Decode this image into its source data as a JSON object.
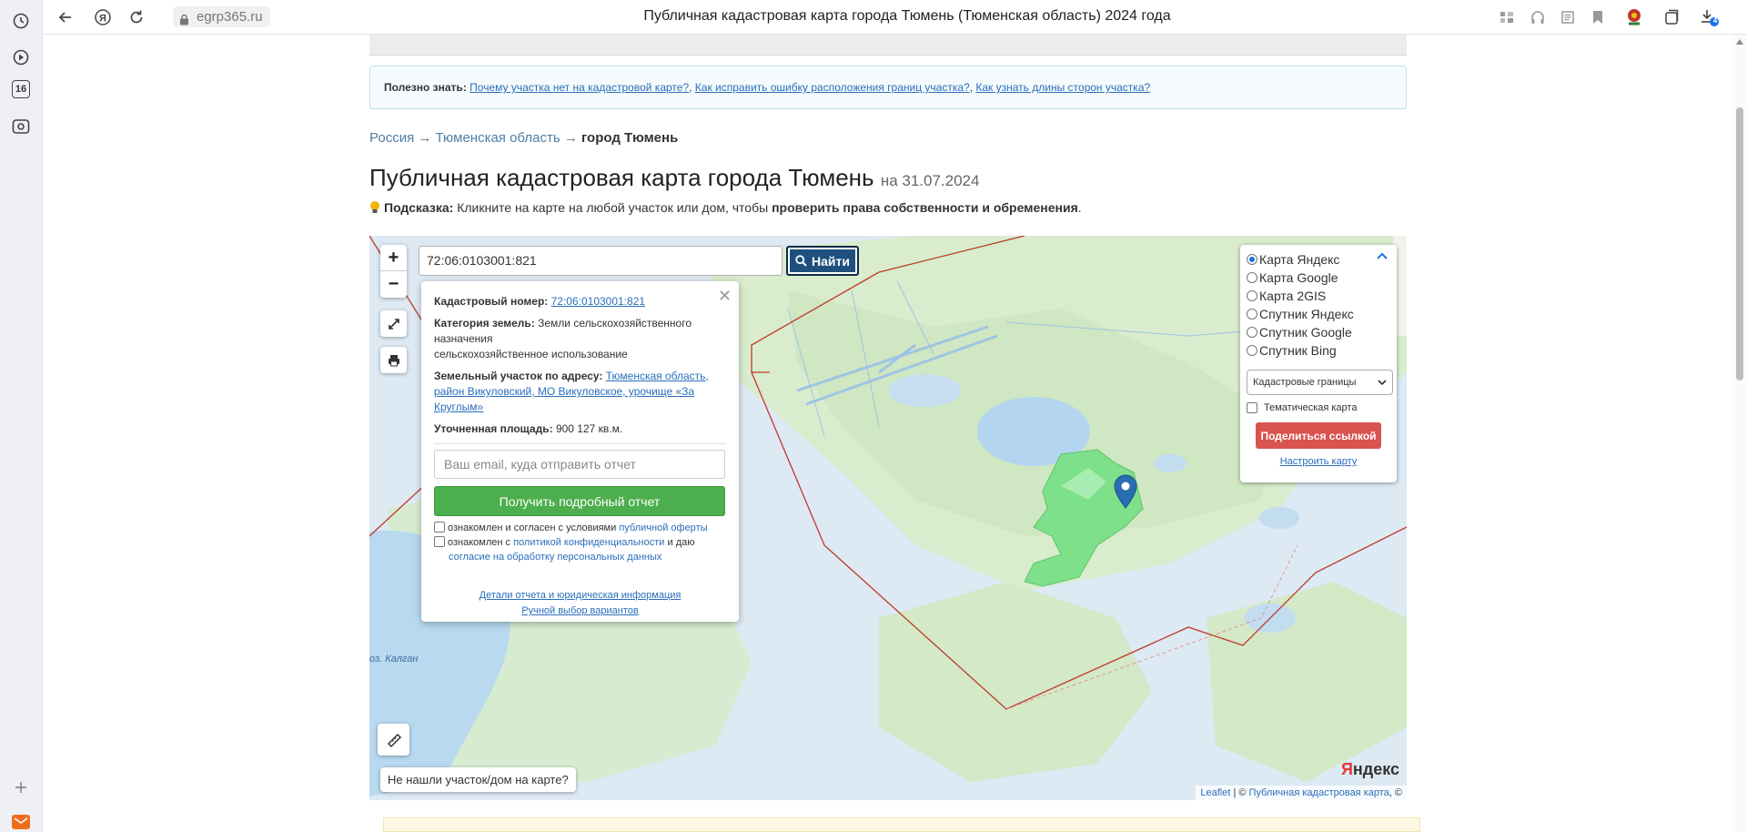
{
  "browser": {
    "url": "egrp365.ru",
    "tab_title": "Публичная кадастровая карта города Тюмень (Тюменская область) 2024 года",
    "rail_badge": "16",
    "download_badge": "4"
  },
  "info": {
    "label": "Полезно знать:",
    "links": [
      "Почему участка нет на кадастровой карте?",
      "Как исправить ошибку расположения границ участка?",
      "Как узнать длины сторон участка?"
    ]
  },
  "breadcrumb": {
    "items": [
      "Россия",
      "Тюменская область"
    ],
    "separator": "→",
    "current": "город Тюмень"
  },
  "title": {
    "main": "Публичная кадастровая карта города Тюмень",
    "date": "на 31.07.2024"
  },
  "hint": {
    "label": "Подсказка:",
    "text": "Кликните на карте на любой участок или дом, чтобы",
    "bold": "проверить права собственности и обременения",
    "end": "."
  },
  "map": {
    "zoom_in": "+",
    "zoom_out": "−",
    "search_value": "72:06:0103001:821",
    "find_label": "Найти",
    "lake_label": "оз. Калган",
    "not_found": "Не нашли участок/дом на карте?",
    "yandex_logo_y": "Я",
    "yandex_logo_rest": "ндекс",
    "attribution_leaflet": "Leaflet",
    "attribution_sep": "| ©",
    "attribution_pkk": "Публичная кадастровая карта",
    "attribution_end": ", ©"
  },
  "popup": {
    "cad_label": "Кадастровый номер:",
    "cad_value": "72:06:0103001:821",
    "cat_label": "Категория земель:",
    "cat_value_1": "Земли сельскохозяйственного назначения",
    "cat_value_2": "сельскохозяйственное использование",
    "addr_label": "Земельный участок по адресу:",
    "addr_value": "Тюменская область, район Викуловский, МО Викуловское, урочище «За Круглым»",
    "area_label": "Уточненная площадь:",
    "area_value": "900 127 кв.м.",
    "email_placeholder": "Ваш email, куда отправить отчет",
    "report_button": "Получить подробный отчет",
    "chk1_text": "ознакомлен и согласен с условиями",
    "chk1_link": "публичной оферты",
    "chk2_text": "ознакомлен с",
    "chk2_link": "политикой конфиденциальности",
    "chk2_mid": "и даю",
    "chk2_link2": "согласие на обработку персональных данных",
    "details_link": "Детали отчета и юридическая информация",
    "manual_link": "Ручной выбор вариантов"
  },
  "layers": {
    "options": [
      "Карта Яндекс",
      "Карта Google",
      "Карта 2GIS",
      "Спутник Яндекс",
      "Спутник Google",
      "Спутник Bing"
    ],
    "selected": 0,
    "overlay_select": "Кадастровые границы",
    "thematic": "Тематическая карта",
    "share": "Поделиться ссылкой",
    "setup": "Настроить карту"
  },
  "colors": {
    "find_button": "#1f4f7c",
    "report_button": "#4cae4c",
    "share_button": "#d9534f",
    "parcel": "#7ee08a",
    "boundary": "#c0392b",
    "marker": "#2a6db0"
  }
}
